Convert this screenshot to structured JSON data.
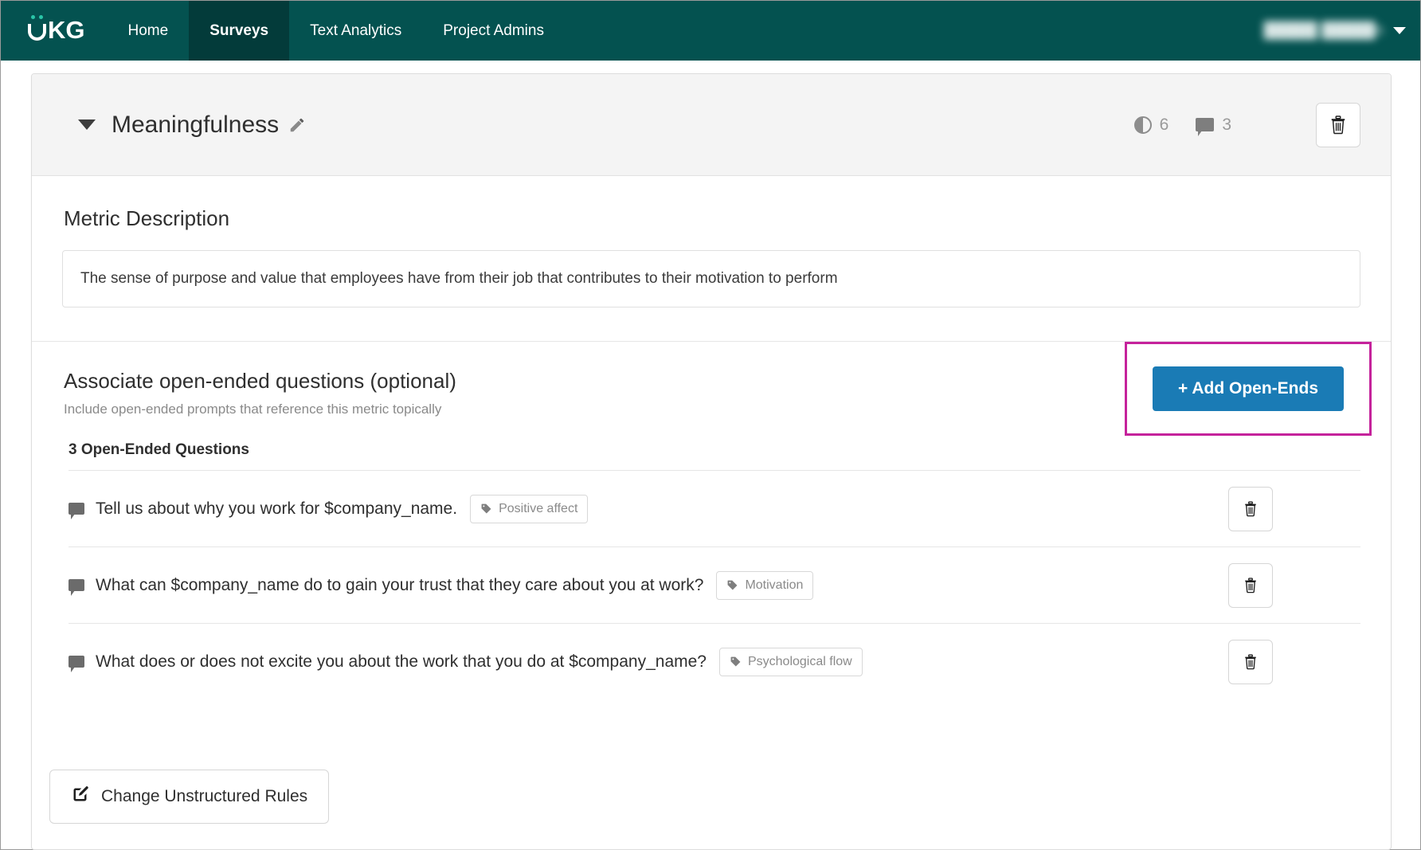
{
  "topnav": {
    "logo_text": "UKG",
    "logo_icon": "ukg-logo-icon",
    "items": [
      {
        "label": "Home",
        "active": false
      },
      {
        "label": "Surveys",
        "active": true
      },
      {
        "label": "Text Analytics",
        "active": false
      },
      {
        "label": "Project Admins",
        "active": false
      }
    ],
    "user": {
      "name_redacted": "█████ █████n",
      "chevron_icon": "chevron-down-icon"
    },
    "colors": {
      "bar": "#045250",
      "active_tab": "#033b3a",
      "logo_accent": "#29c5a8"
    }
  },
  "metric_card": {
    "collapse_icon": "caret-down-icon",
    "title": "Meaningfulness",
    "edit_icon": "pencil-icon",
    "stats": [
      {
        "icon": "contrast-half-circle-icon",
        "value": "6"
      },
      {
        "icon": "comment-bubble-icon",
        "value": "3"
      }
    ],
    "delete_icon": "trash-icon"
  },
  "description": {
    "section_title": "Metric Description",
    "text": "The sense of purpose and value that employees have from their job that contributes to their motivation to perform"
  },
  "associate": {
    "title": "Associate open-ended questions (optional)",
    "subtitle": "Include open-ended prompts that reference this metric topically",
    "add_button_label": "+ Add Open-Ends",
    "add_button_color": "#1a7bb5",
    "highlight_color": "#c5229b",
    "count_label": "3 Open-Ended Questions",
    "questions": [
      {
        "icon": "comment-bubble-icon",
        "text": "Tell us about why you work for $company_name.",
        "tag": "Positive affect",
        "tag_icon": "tag-icon",
        "delete_icon": "trash-icon"
      },
      {
        "icon": "comment-bubble-icon",
        "text": "What can $company_name do to gain your trust that they care about you at work?",
        "tag": "Motivation",
        "tag_icon": "tag-icon",
        "delete_icon": "trash-icon"
      },
      {
        "icon": "comment-bubble-icon",
        "text": "What does or does not excite you about the work that you do at $company_name?",
        "tag": "Psychological flow",
        "tag_icon": "tag-icon",
        "delete_icon": "trash-icon"
      }
    ]
  },
  "footer": {
    "rules_button_label": "Change Unstructured Rules",
    "rules_button_icon": "edit-square-icon"
  }
}
